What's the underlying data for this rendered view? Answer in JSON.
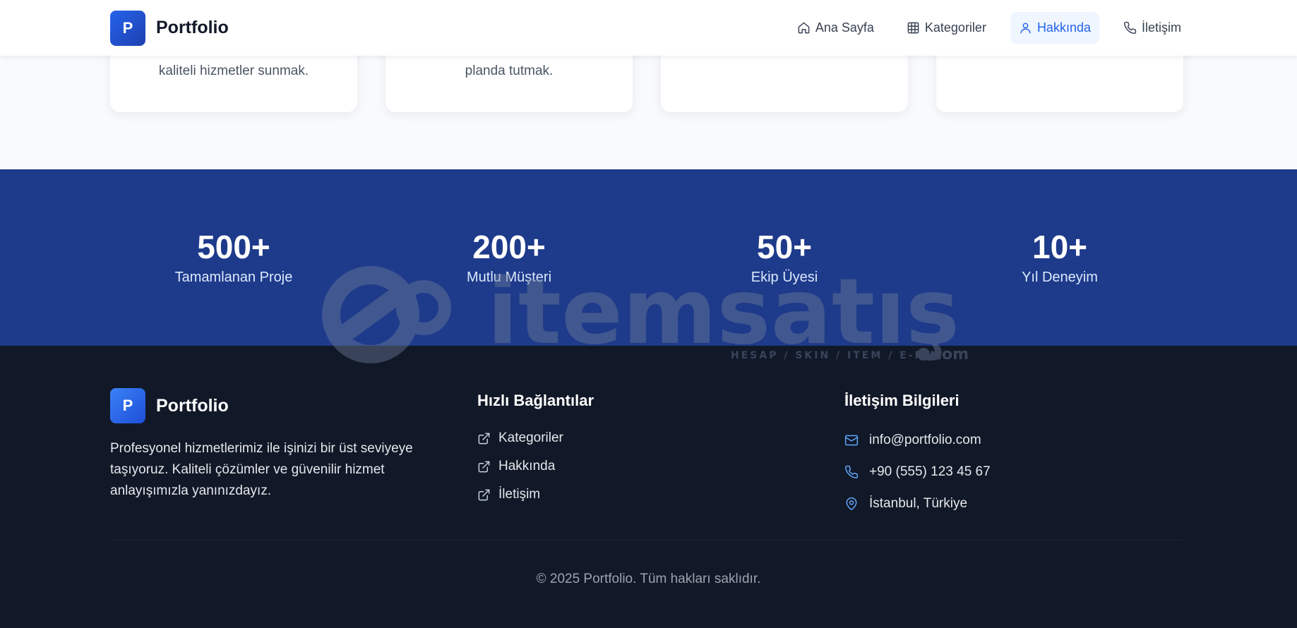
{
  "header": {
    "logo_letter": "P",
    "brand": "Portfolio",
    "nav": [
      {
        "label": "Ana Sayfa",
        "icon": "home-icon"
      },
      {
        "label": "Kategoriler",
        "icon": "grid-icon"
      },
      {
        "label": "Hakkında",
        "icon": "user-icon",
        "active": true
      },
      {
        "label": "İletişim",
        "icon": "phone-icon"
      }
    ]
  },
  "values_cards": [
    {
      "text_visible": "kaliteli hizmetler sunmak."
    },
    {
      "text_visible": "planda tutmak."
    },
    {
      "text_visible": ""
    },
    {
      "text_visible": ""
    }
  ],
  "stats": [
    {
      "number": "500+",
      "label": "Tamamlanan Proje"
    },
    {
      "number": "200+",
      "label": "Mutlu Müşteri"
    },
    {
      "number": "50+",
      "label": "Ekip Üyesi"
    },
    {
      "number": "10+",
      "label": "Yıl Deneyim"
    }
  ],
  "watermark": {
    "main": "itemsatış",
    "sub": "HESAP / SKIN / ITEM / E-PIN",
    "tld": "com"
  },
  "footer": {
    "logo_letter": "P",
    "brand": "Portfolio",
    "description": "Profesyonel hizmetlerimiz ile işinizi bir üst seviyeye taşıyoruz. Kaliteli çözümler ve güvenilir hizmet anlayışımızla yanınızdayız.",
    "quick_links_title": "Hızlı Bağlantılar",
    "quick_links": [
      "Kategoriler",
      "Hakkında",
      "İletişim"
    ],
    "contact_title": "İletişim Bilgileri",
    "contact": {
      "email": "info@portfolio.com",
      "phone": "+90 (555) 123 45 67",
      "location": "İstanbul, Türkiye"
    },
    "copyright": "© 2025 Portfolio. Tüm hakları saklıdır."
  },
  "colors": {
    "accent": "#2563eb",
    "stats_bg": "#1e3a8a",
    "footer_bg": "#111827"
  }
}
